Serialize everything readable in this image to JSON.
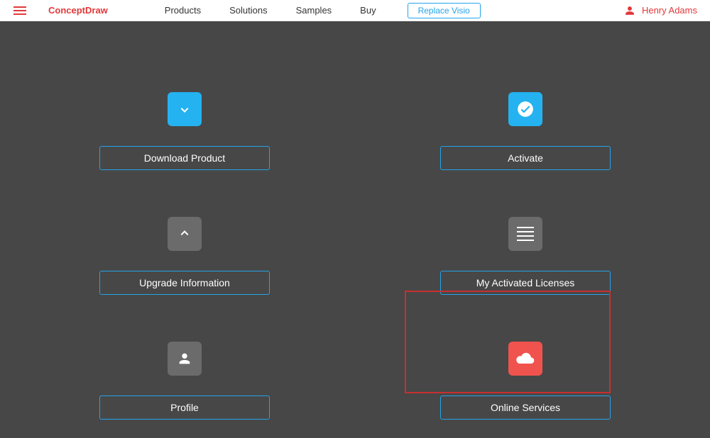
{
  "brand": "ConceptDraw",
  "nav": {
    "products": "Products",
    "solutions": "Solutions",
    "samples": "Samples",
    "buy": "Buy",
    "replace": "Replace Visio"
  },
  "user_name": "Henry Adams",
  "tiles": {
    "download": "Download Product",
    "activate": "Activate",
    "upgrade": "Upgrade Information",
    "licenses": "My Activated Licenses",
    "profile": "Profile",
    "online": "Online Services"
  }
}
